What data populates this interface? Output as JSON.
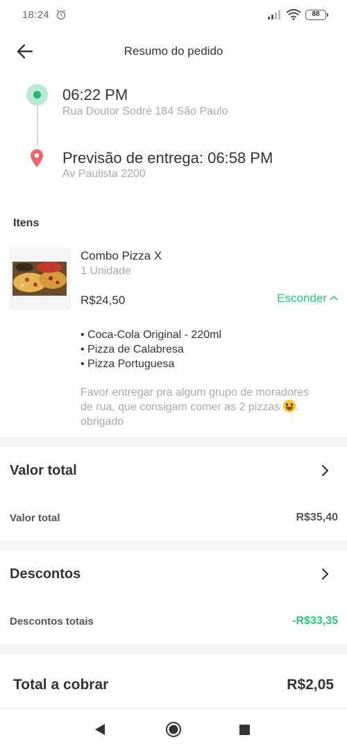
{
  "status_bar": {
    "time": "18:24",
    "battery": "88"
  },
  "header": {
    "title": "Resumo do pedido"
  },
  "timeline": {
    "origin": {
      "time": "06:22 PM",
      "address": "Rua Doutor Sodré 184  São Paulo"
    },
    "destination": {
      "title": "Previsão de entrega: 06:58 PM",
      "address": "Av Paulista 2200"
    }
  },
  "items_section": {
    "label": "Itens"
  },
  "item": {
    "name": "Combo Pizza X",
    "quantity": "1 Unidade",
    "price": "R$24,50",
    "toggle_label": "Esconder",
    "sub_items": [
      "• Coca-Cola Original - 220ml",
      "• Pizza de Calabresa",
      "• Pizza Portuguesa"
    ],
    "note_line1": "Favor entregar pra algum grupo de moradores",
    "note_line2": "de rua, que consigam comer as 2 pizzas",
    "note_line3": "obrigado"
  },
  "valor_total": {
    "title": "Valor total",
    "row_label": "Valor total",
    "row_value": "R$35,40"
  },
  "descontos": {
    "title": "Descontos",
    "row_label": "Descontos totais",
    "row_value": "-R$33,35"
  },
  "total": {
    "label": "Total a cobrar",
    "value": "R$2,05"
  },
  "colors": {
    "accent_green": "#2ec27e",
    "pin_red": "#f0646a",
    "divider": "#f4f4f4"
  },
  "icons": [
    "alarm-icon",
    "signal-icon",
    "wifi-icon",
    "back-arrow-icon",
    "location-pin-icon",
    "chevron-up-icon",
    "chevron-right-icon",
    "nav-back-icon",
    "nav-home-icon",
    "nav-recents-icon"
  ]
}
